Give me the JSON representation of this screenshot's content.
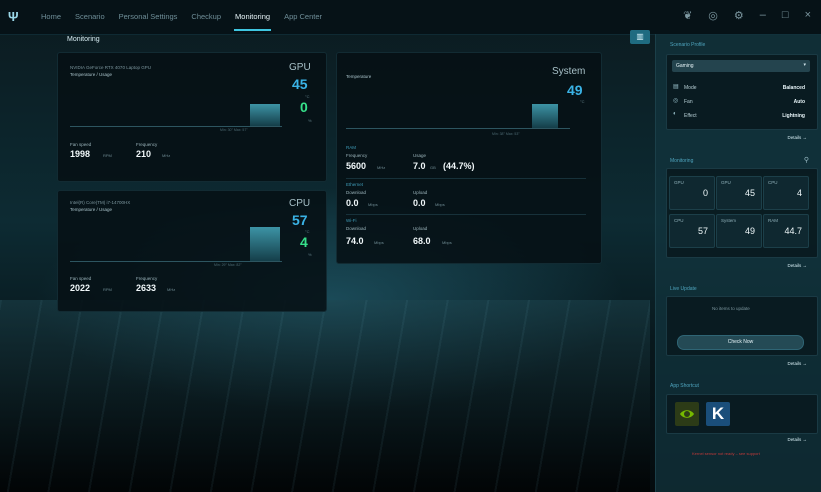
{
  "nav": {
    "logo": "Ψ",
    "items": [
      "Home",
      "Scenario",
      "Personal Settings",
      "Checkup",
      "Monitoring",
      "App Center"
    ],
    "active_index": 4,
    "icons": [
      "save-icon",
      "headset-icon",
      "gear-icon",
      "minimize-icon",
      "restore-icon",
      "close-icon"
    ],
    "icon_glyphs": [
      "❦",
      "◎",
      "⚙",
      "–",
      "□",
      "×"
    ]
  },
  "page": {
    "title": "Monitoring",
    "collapse_glyph": "▥"
  },
  "gpu_card": {
    "name": "NVIDIA GeForce RTX 4070 Laptop GPU",
    "subtitle": "Temperature / Usage",
    "label": "GPU",
    "temp": "45",
    "temp_unit": "°C",
    "usage": "0",
    "usage_unit": "%",
    "axis": "Min: 30°  Max: 57°",
    "fan_label": "Fan speed",
    "fan_value": "1998",
    "fan_unit": "RPM",
    "freq_label": "Frequency",
    "freq_value": "210",
    "freq_unit": "MHz"
  },
  "cpu_card": {
    "name": "Intel(R) Core(TM) i7-14700HX",
    "subtitle": "Temperature / Usage",
    "label": "CPU",
    "temp": "57",
    "temp_unit": "°C",
    "usage": "4",
    "usage_unit": "%",
    "axis": "Min: 29°  Max: 82°",
    "fan_label": "Fan speed",
    "fan_value": "2022",
    "fan_unit": "RPM",
    "freq_label": "Frequency",
    "freq_value": "2633",
    "freq_unit": "MHz"
  },
  "system_card": {
    "subtitle": "Temperature",
    "label": "System",
    "temp": "49",
    "temp_unit": "°C",
    "axis": "Min: 38°  Max: 53°",
    "ram_title": "RAM",
    "ram_freq_label": "Frequency",
    "ram_freq_value": "5600",
    "ram_freq_unit": "MHz",
    "ram_usage_label": "Usage",
    "ram_usage_value": "7.0",
    "ram_usage_unit": "GB",
    "ram_usage_pct": "(44.7%)",
    "eth_title": "Ethernet",
    "eth_down_label": "Download",
    "eth_down_value": "0.0",
    "eth_down_unit": "Mbps",
    "eth_up_label": "Upload",
    "eth_up_value": "0.0",
    "eth_up_unit": "Mbps",
    "wifi_title": "Wi-Fi",
    "wifi_down_label": "Download",
    "wifi_down_value": "74.0",
    "wifi_down_unit": "Mbps",
    "wifi_up_label": "Upload",
    "wifi_up_value": "68.0",
    "wifi_up_unit": "Mbps"
  },
  "scenario": {
    "title": "Scenario Profile",
    "selected": "Gaming",
    "rows": [
      {
        "label": "Mode",
        "value": "Balanced",
        "icon": "mode-icon"
      },
      {
        "label": "Fan",
        "value": "Auto",
        "icon": "fan-icon"
      },
      {
        "label": "Effect",
        "value": "Lightning",
        "icon": "effect-icon"
      }
    ],
    "details": "Details →"
  },
  "monitoring": {
    "title": "Monitoring",
    "tiles": [
      {
        "label": "GPU",
        "value": "0"
      },
      {
        "label": "GPU",
        "value": "45"
      },
      {
        "label": "CPU",
        "value": "4"
      },
      {
        "label": "CPU",
        "value": "57"
      },
      {
        "label": "System",
        "value": "49"
      },
      {
        "label": "RAM",
        "value": "44.7"
      }
    ],
    "details": "Details →"
  },
  "live_update": {
    "title": "Live Update",
    "message": "No items to update",
    "button": "Check Now",
    "details": "Details →"
  },
  "app_shortcut": {
    "title": "App Shortcut",
    "apps": [
      "nvidia-app-icon",
      "k-app-icon"
    ],
    "k_glyph": "K",
    "details": "Details →",
    "warning": "Kernel sensor not ready – see support"
  },
  "colors": {
    "accent": "#3fc6e0",
    "value_blue": "#3ab3e6",
    "value_green": "#36e08a"
  }
}
